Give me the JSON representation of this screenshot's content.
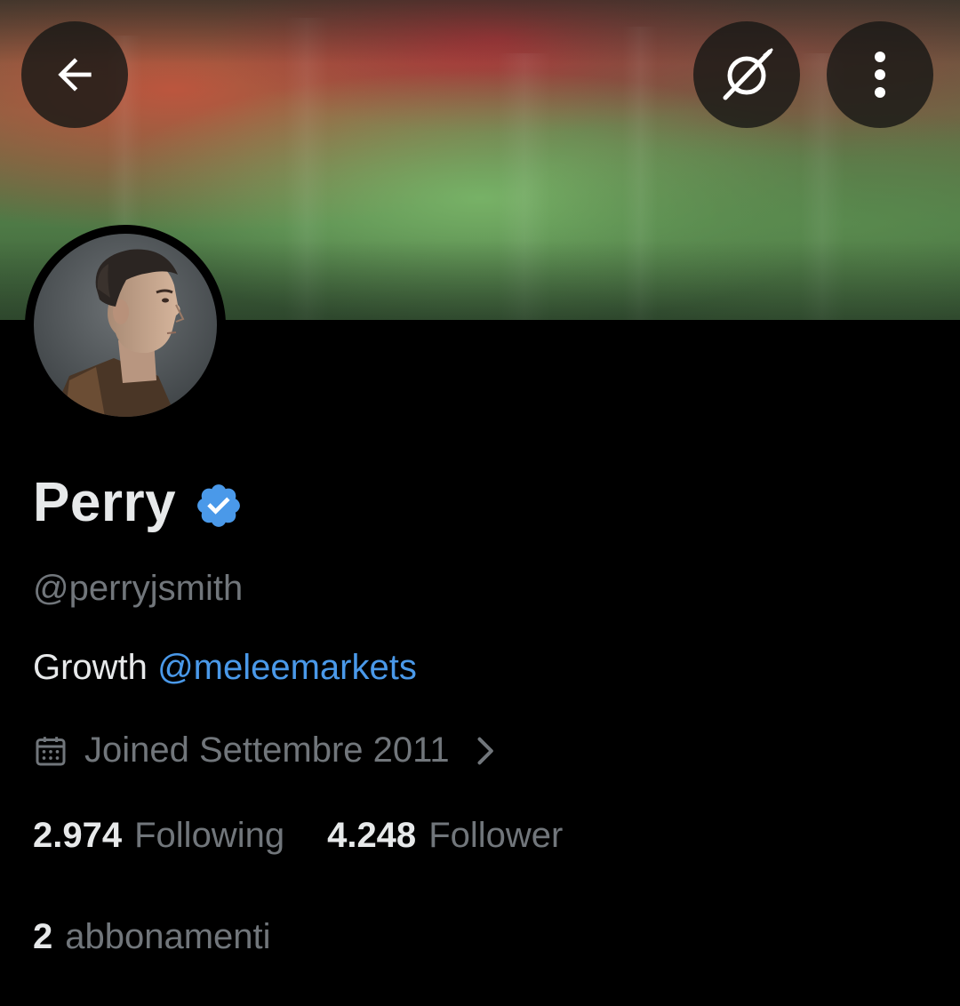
{
  "profile": {
    "display_name": "Perry",
    "handle": "@perryjsmith",
    "bio": {
      "text": "Growth",
      "mention": "@meleemarkets"
    },
    "joined": "Joined Settembre 2011",
    "following_count": "2.974",
    "following_label": "Following",
    "follower_count": "4.248",
    "follower_label": "Follower",
    "subscriptions_count": "2",
    "subscriptions_label": "abbonamenti"
  },
  "header": {
    "back_icon": "arrow-left-icon",
    "grok_icon": "grok-icon",
    "more_icon": "more-vertical-icon"
  },
  "icons": {
    "verified": "verified-badge-icon",
    "calendar": "calendar-icon",
    "chevron": "chevron-right-icon"
  },
  "colors": {
    "background": "#000000",
    "primary_text": "#e7e9ea",
    "secondary_text": "#71767b",
    "link": "#4a99e9",
    "verified": "#4a99e9"
  }
}
